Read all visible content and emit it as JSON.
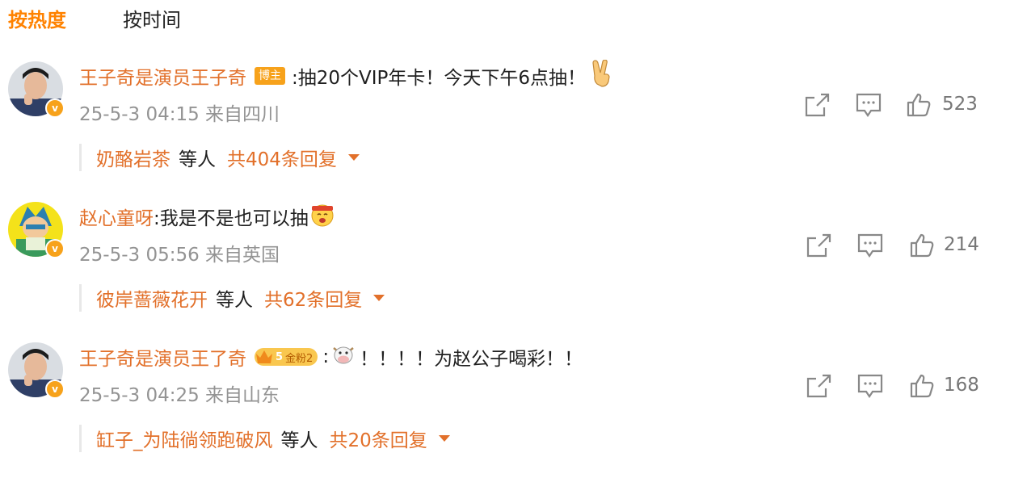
{
  "tabs": {
    "hot_label": "按热度",
    "time_label": "按时间"
  },
  "comments": [
    {
      "username": "王子奇是演员王子奇",
      "badge": "博主",
      "text": ":抽20个VIP年卡！今天下午6点抽！",
      "emoji_icon": "victory-hand-icon",
      "time": "25-5-3 04:15 来自四川",
      "likes": "523",
      "reply_user": "奶酪岩茶",
      "reply_etc": "等人",
      "reply_count": "共404条回复"
    },
    {
      "username": "赵心童呀",
      "text": ":我是不是也可以抽",
      "emoji_icon": "hungry-face-icon",
      "time": "25-5-3 05:56 来自英国",
      "likes": "214",
      "reply_user": "彼岸蔷薇花开",
      "reply_etc": "等人",
      "reply_count": "共62条回复"
    },
    {
      "username": "王子奇是演员王了奇",
      "fan_badge": "金粉2",
      "fan_level": "5",
      "text_prefix": ":",
      "text": "！！！！为赵公子喝彩！！",
      "emoji_icon": "cow-face-icon",
      "time": "25-5-3 04:25 来自山东",
      "likes": "168",
      "reply_user": "缸子_为陆徜领跑破风",
      "reply_etc": "等人",
      "reply_count": "共20条回复"
    }
  ],
  "colors": {
    "accent": "#ff8200",
    "username": "#e2702a",
    "meta": "#939393",
    "badge": "#f7a21b"
  }
}
